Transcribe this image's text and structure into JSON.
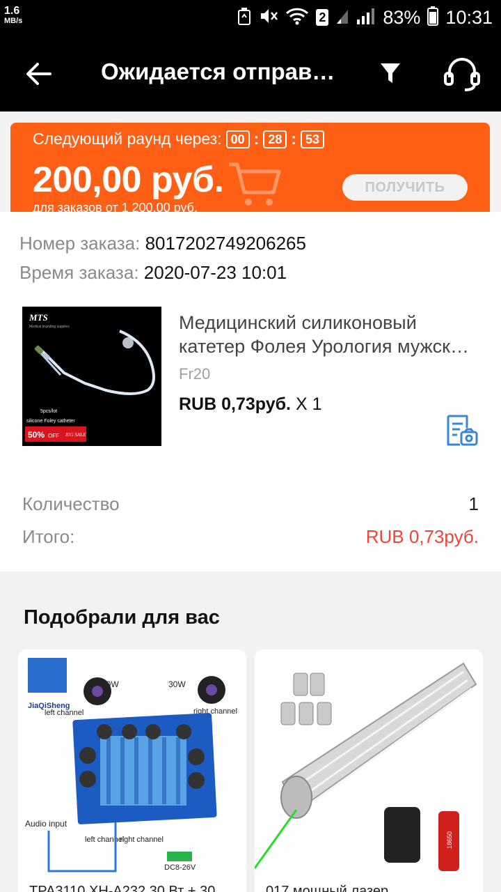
{
  "status_bar": {
    "network_speed": "1.6",
    "network_unit": "MB/s",
    "sim_badge": "2",
    "battery": "83%",
    "time": "10:31"
  },
  "toolbar": {
    "title": "Ожидается отправ…",
    "icons": [
      "back-arrow-icon",
      "filter-icon",
      "headset-icon"
    ]
  },
  "banner": {
    "round_label": "Следующий раунд через:",
    "timer": [
      "00",
      "28",
      "53"
    ],
    "amount": "200,00 руб.",
    "condition": "для заказов от 1 200,00 руб.",
    "get_button": "ПОЛУЧИТЬ",
    "color": "#ff5f14"
  },
  "order": {
    "number_label": "Номер заказа:",
    "number_value": "8017202749206265",
    "time_label": "Время заказа:",
    "time_value": "2020-07-23 10:01",
    "product": {
      "title_line1": "Медицинский силиконовый",
      "title_line2": "катетер Фолея Урология мужск…",
      "variant": "Fr20",
      "price": "RUB 0,73руб.",
      "qty": "X 1",
      "image_text": {
        "brand": "MTS",
        "tagline": "Medical branding supplies",
        "pack": "5pcs/lot",
        "caption": "silicone Foley catheter",
        "sale": "50%",
        "sale_suffix": "OFF",
        "big_sale": "BIG SALE"
      }
    },
    "quantity_label": "Количество",
    "quantity_value": "1",
    "total_label": "Итого:",
    "total_value": "RUB 0,73руб."
  },
  "recommendations": {
    "title": "Подобрали для вас",
    "items": [
      {
        "name": "TPA3110 XH-A232 30 Вт + 30",
        "image_text": {
          "brand": "JiaQiSheng",
          "power_left": "30W",
          "power_right": "30W",
          "left_channel": "left channel",
          "right_channel": "right channel",
          "audio_input": "Audio input",
          "left_ch_short": "left channel",
          "right_ch_short": "right channel",
          "voltage": "DC8-26V"
        }
      },
      {
        "name": "017 мощный лазер",
        "image_text": {
          "battery_label": "18650"
        }
      }
    ]
  }
}
